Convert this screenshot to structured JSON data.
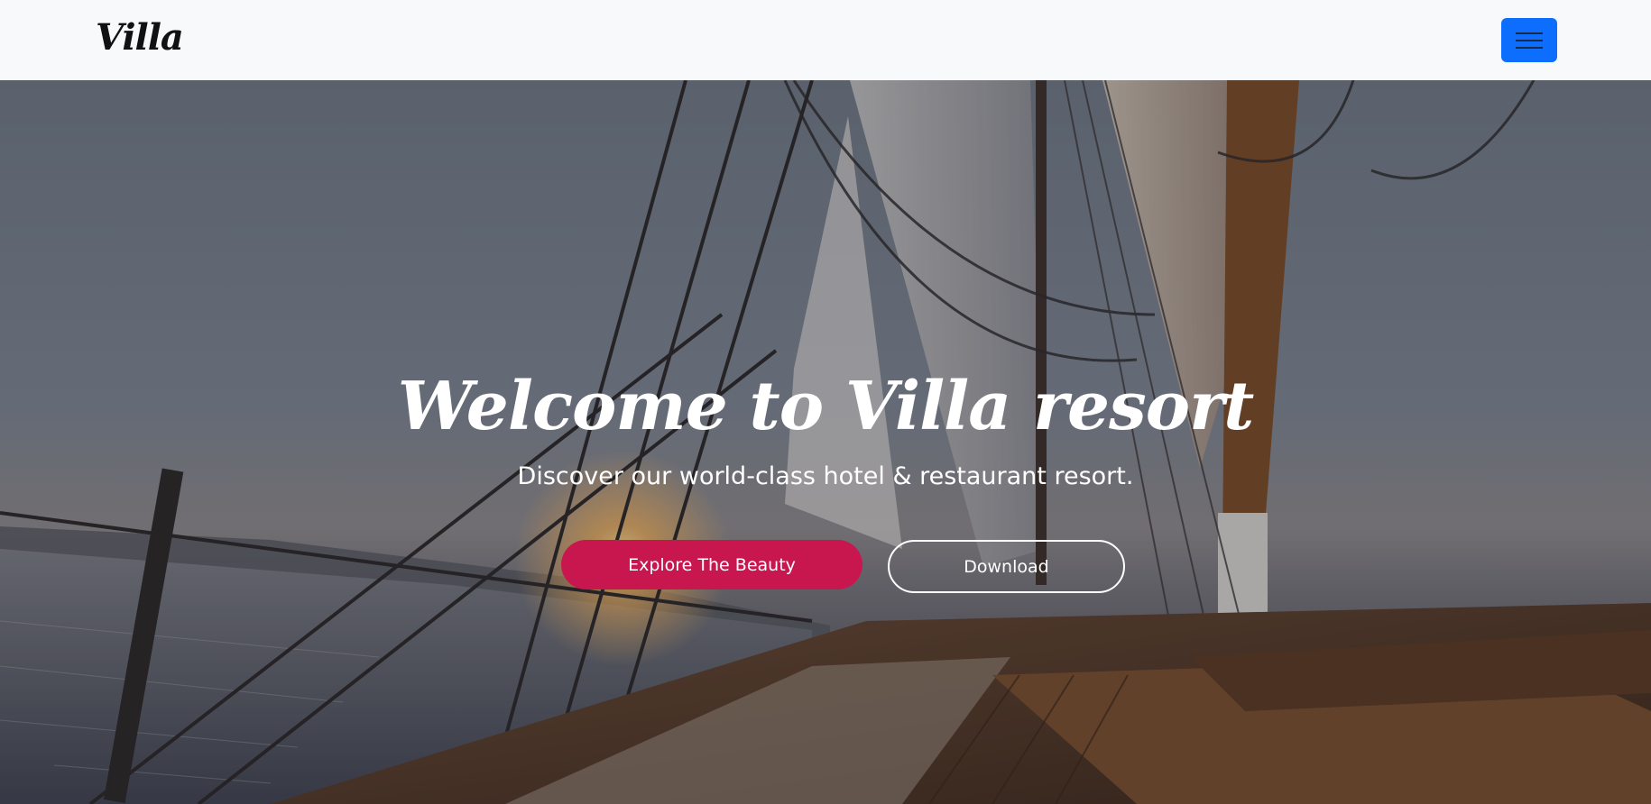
{
  "navbar": {
    "brand": "Villa",
    "menu_toggle_icon": "hamburger-menu-icon",
    "menu_toggle_color": "#0d6efd"
  },
  "hero": {
    "title": "Welcome to Villa resort",
    "subtitle": "Discover our world-class hotel & restaurant resort.",
    "primary_button": "Explore The Beauty",
    "secondary_button": "Download",
    "background_description_icon": "sailboat-sunset-image"
  },
  "colors": {
    "primary_button": "#c8174e",
    "navbar_bg": "#f8f9fa"
  }
}
